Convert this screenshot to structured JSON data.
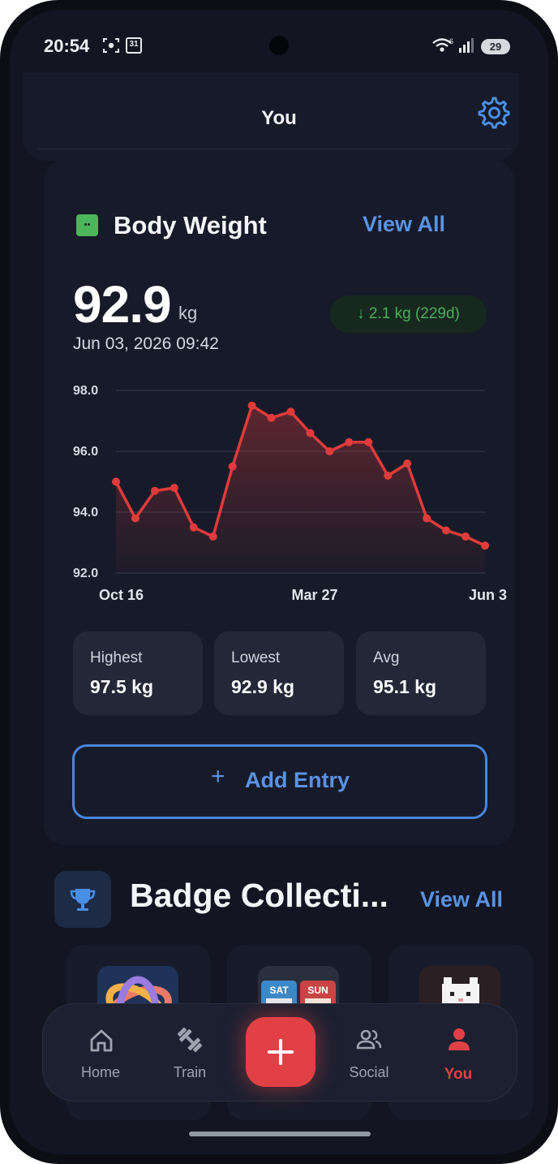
{
  "status_bar": {
    "time": "20:54",
    "calendar_day": "31",
    "battery": "29"
  },
  "header": {
    "title": "You"
  },
  "body_weight": {
    "title": "Body Weight",
    "view_all": "View All",
    "current_value": "92.9",
    "unit": "kg",
    "date": "Jun 03, 2026 09:42",
    "change": "2.1 kg (229d)",
    "stats": [
      {
        "label": "Highest",
        "value": "97.5 kg"
      },
      {
        "label": "Lowest",
        "value": "92.9 kg"
      },
      {
        "label": "Avg",
        "value": "95.1 kg"
      }
    ],
    "add_entry": "Add Entry"
  },
  "chart_data": {
    "type": "area",
    "ylim": [
      92,
      98
    ],
    "y_ticks": [
      "98.0",
      "96.0",
      "94.0",
      "92.0"
    ],
    "x_tick_labels": [
      "Oct 16",
      "Mar 27",
      "Jun 3"
    ],
    "grid": true,
    "series": [
      {
        "values": [
          95.0,
          93.8,
          94.7,
          94.8,
          93.5,
          93.2,
          95.5,
          97.5,
          97.1,
          97.3,
          96.6,
          96.0,
          96.3,
          96.3,
          95.2,
          95.6,
          93.8,
          93.4,
          93.2,
          92.9
        ]
      }
    ]
  },
  "badges": {
    "title": "Badge Collecti...",
    "view_all": "View All"
  },
  "nav": {
    "items": [
      "Home",
      "Train",
      "Social",
      "You"
    ],
    "active": "You"
  },
  "colors": {
    "accent_blue": "#5a92e3",
    "accent_red": "#e14144",
    "positive_green": "#4cae5a",
    "chart_line": "#e03b3b"
  }
}
